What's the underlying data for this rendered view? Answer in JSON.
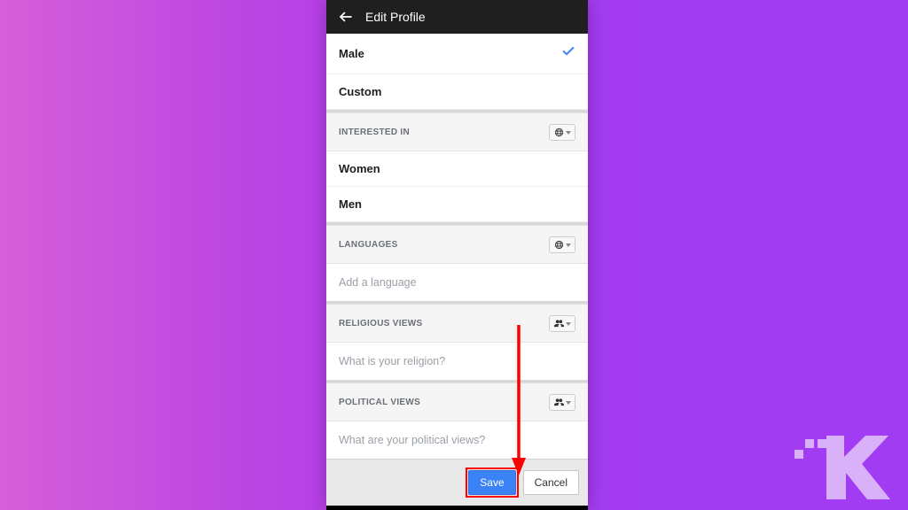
{
  "header": {
    "title": "Edit Profile"
  },
  "gender": {
    "male": "Male",
    "custom": "Custom"
  },
  "interested": {
    "heading": "INTERESTED IN",
    "women": "Women",
    "men": "Men"
  },
  "languages": {
    "heading": "LANGUAGES",
    "placeholder": "Add a language"
  },
  "religion": {
    "heading": "RELIGIOUS VIEWS",
    "placeholder": "What is your religion?"
  },
  "politics": {
    "heading": "POLITICAL VIEWS",
    "placeholder": "What are your political views?"
  },
  "footer": {
    "save": "Save",
    "cancel": "Cancel"
  }
}
